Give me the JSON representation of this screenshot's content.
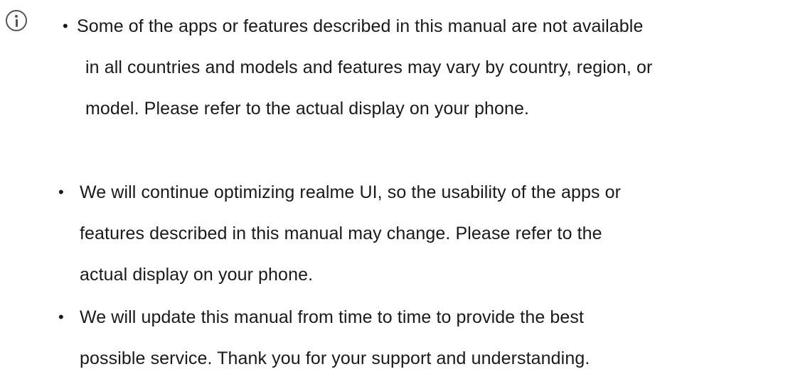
{
  "notice": {
    "icon": "info-icon",
    "bullet_char": "•",
    "items": [
      {
        "lines": [
          "Some of the apps or features described in this manual are not available",
          "in all countries and models and features may vary by country, region, or",
          "model. Please refer to the actual display on your phone."
        ]
      },
      {
        "lines": [
          "We will continue optimizing realme UI, so the usability of the apps or",
          "features described in this manual may change. Please refer to the",
          "actual display on your phone."
        ]
      },
      {
        "lines": [
          "We will update this manual from time to time to provide the best",
          "possible service. Thank you for your support and understanding."
        ]
      }
    ]
  }
}
